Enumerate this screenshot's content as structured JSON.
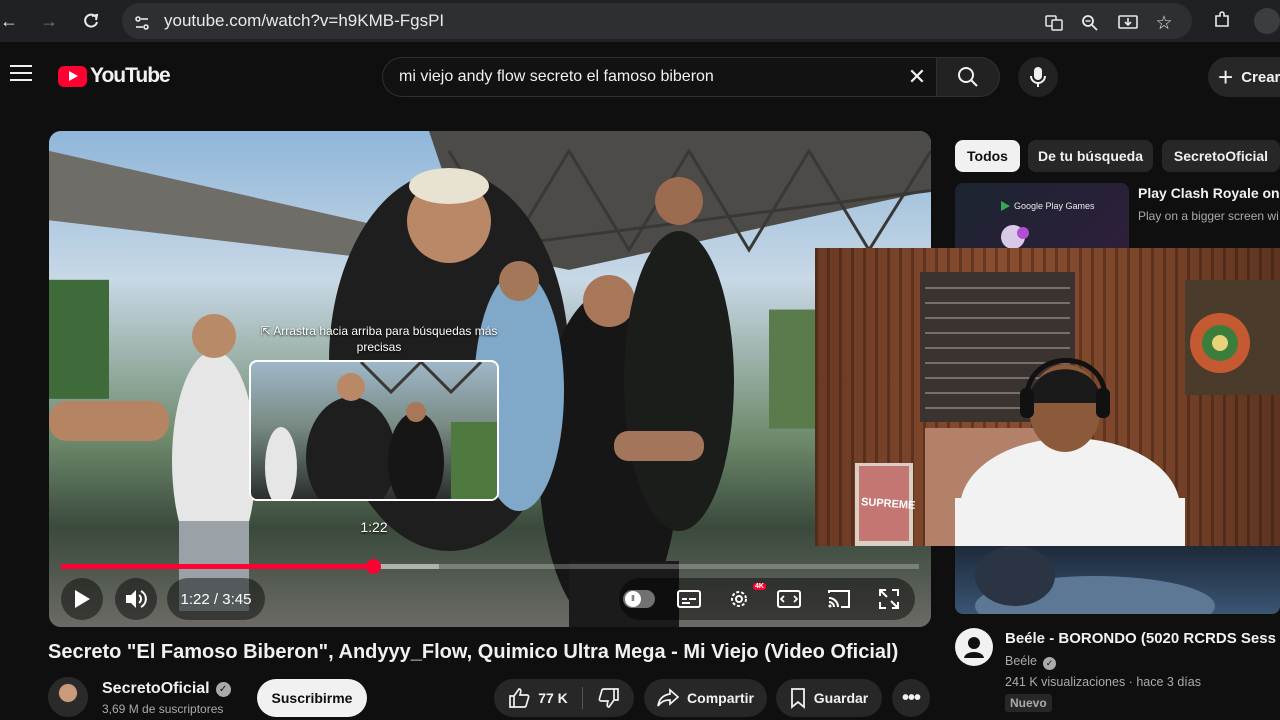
{
  "browser": {
    "url": "youtube.com/watch?v=h9KMB-FgsPI"
  },
  "header": {
    "logo_text": "YouTube",
    "search_query": "mi viejo andy flow secreto el famoso biberon",
    "create_label": "Crear"
  },
  "player": {
    "drag_hint": "⇱ Arrastra hacia arriba para búsquedas más precisas",
    "preview_time": "1:22",
    "time_display": "1:22 / 3:45",
    "progress_fraction": 0.364,
    "buffer_fraction": 0.44,
    "hd_badge": "4K"
  },
  "video": {
    "title": "Secreto \"El Famoso Biberon\", Andyyy_Flow, Quimico Ultra Mega - Mi Viejo (Video Oficial)",
    "channel_name": "SecretoOficial",
    "subscribers": "3,69 M de suscriptores",
    "subscribe_label": "Suscribirme",
    "likes": "77 K",
    "share_label": "Compartir",
    "save_label": "Guardar"
  },
  "sidebar": {
    "chips": [
      "Todos",
      "De tu búsqueda",
      "SecretoOficial"
    ],
    "ad": {
      "brand": "Google Play Games",
      "title": "Play Clash Royale on P",
      "description": "Play on a bigger screen wi controls. Download Googl"
    },
    "rec": {
      "title": "Beéle - BORONDO (5020 RCRDS Sess",
      "channel": "Beéle",
      "stats": "241 K visualizaciones · hace 3 días",
      "badge": "Nuevo"
    },
    "webcam_text": "SUPREME"
  },
  "colors": {
    "accent": "#ff0033",
    "background": "#0f0f0f"
  }
}
